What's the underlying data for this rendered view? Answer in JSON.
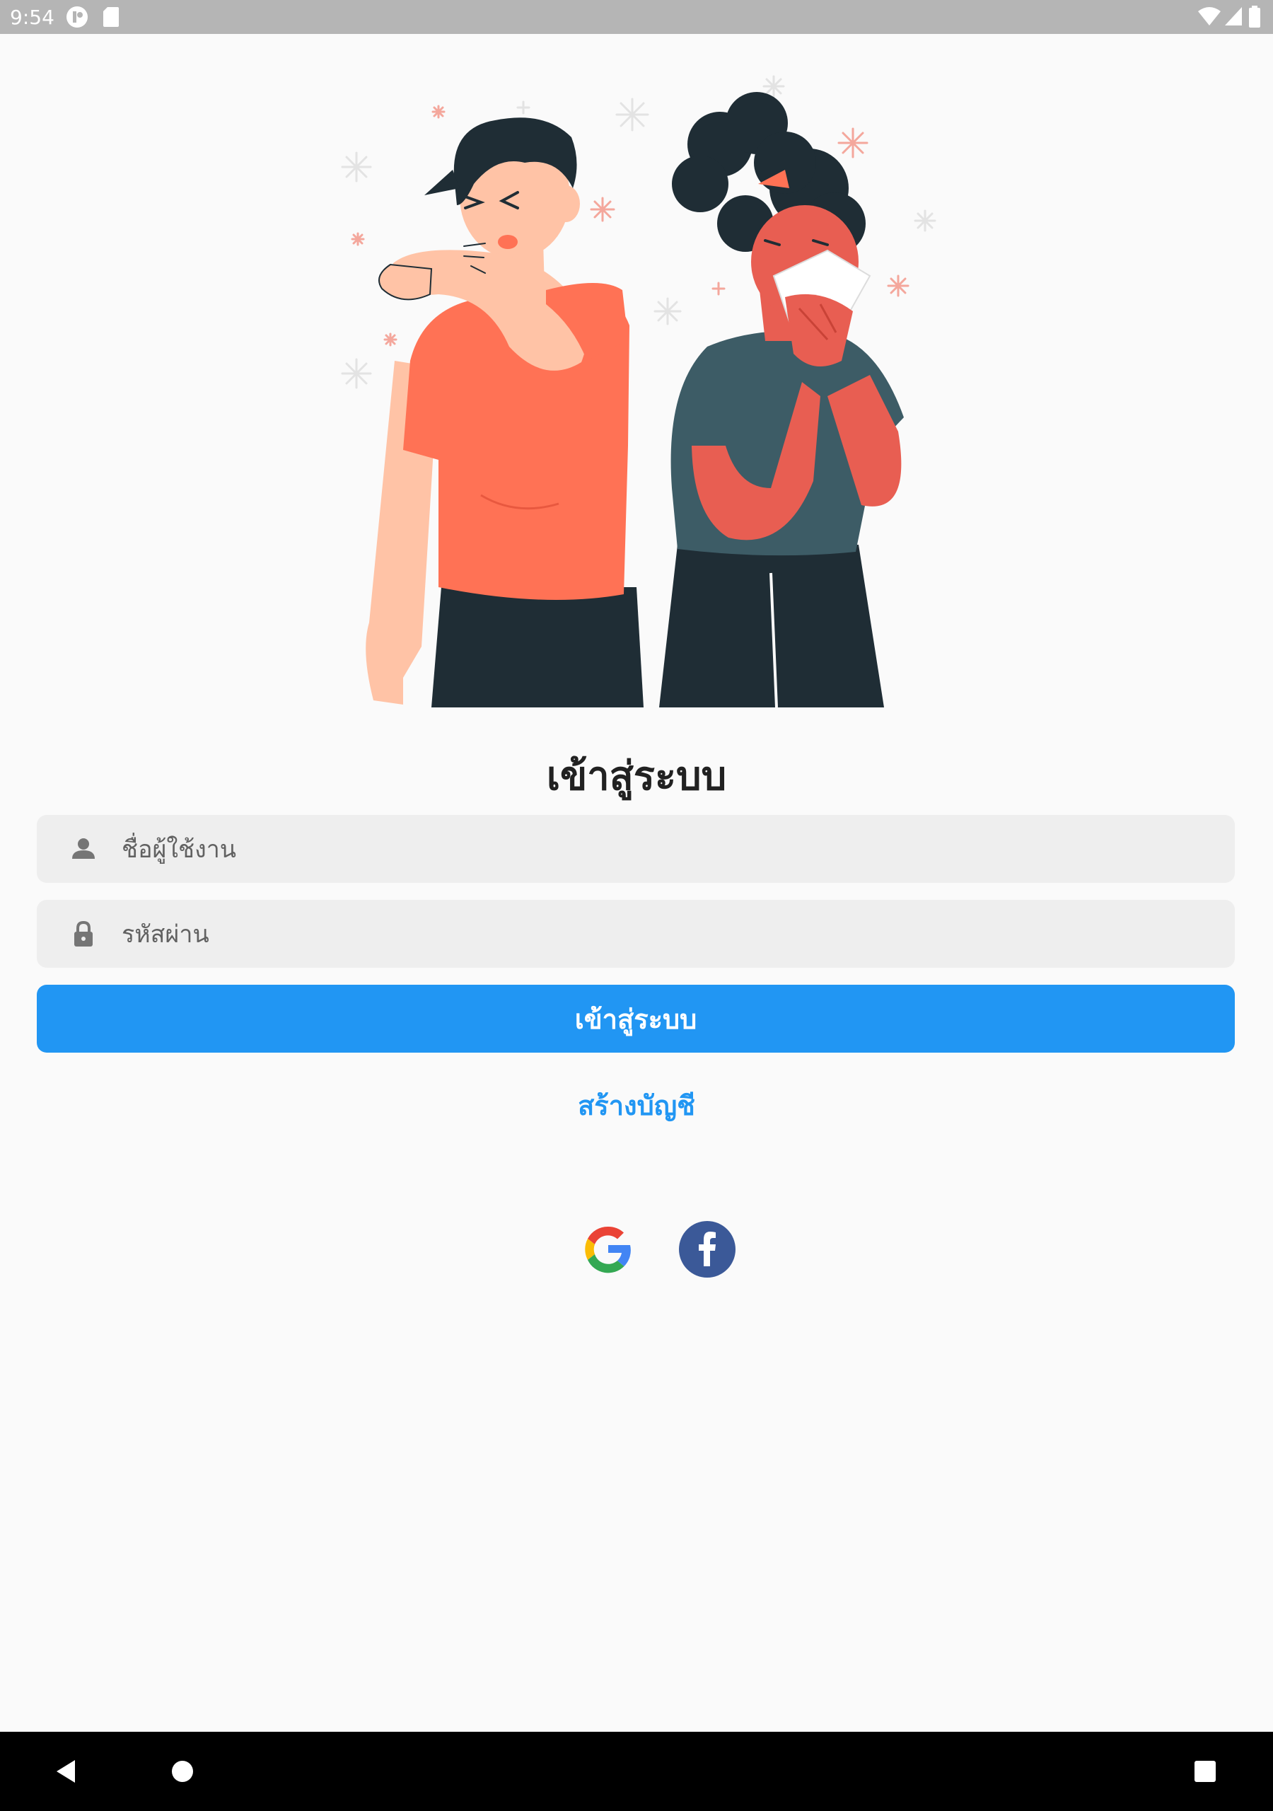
{
  "status_bar": {
    "time": "9:54",
    "icons": [
      "app-notification-icon",
      "sd-card-icon",
      "wifi-icon",
      "cell-signal-icon",
      "battery-icon"
    ]
  },
  "illustration": {
    "subject": "man-sneezing-into-elbow-and-woman-sneezing-into-tissue",
    "colors": {
      "shirt_coral": "#ff7255",
      "shirt_slate": "#3d5c66",
      "pants": "#1f2d35",
      "hair": "#1f2d35",
      "skin_light": "#ffc3a6",
      "skin_red": "#e85e52"
    }
  },
  "login": {
    "title": "เข้าสู่ระบบ",
    "username": {
      "placeholder": "ชื่อผู้ใช้งาน",
      "value": "",
      "icon": "person-icon"
    },
    "password": {
      "placeholder": "รหัสผ่าน",
      "value": "",
      "icon": "lock-icon"
    },
    "submit_label": "เข้าสู่ระบบ",
    "create_account_label": "สร้างบัญชี"
  },
  "social": [
    {
      "name": "google",
      "icon": "google-icon"
    },
    {
      "name": "facebook",
      "icon": "facebook-icon"
    }
  ],
  "nav_bar": {
    "buttons": [
      "back-icon",
      "home-icon",
      "recents-icon"
    ]
  },
  "colors": {
    "accent": "#2196f3",
    "field_bg": "#eeeeee",
    "background": "#fafafa",
    "facebook": "#3b5998"
  }
}
